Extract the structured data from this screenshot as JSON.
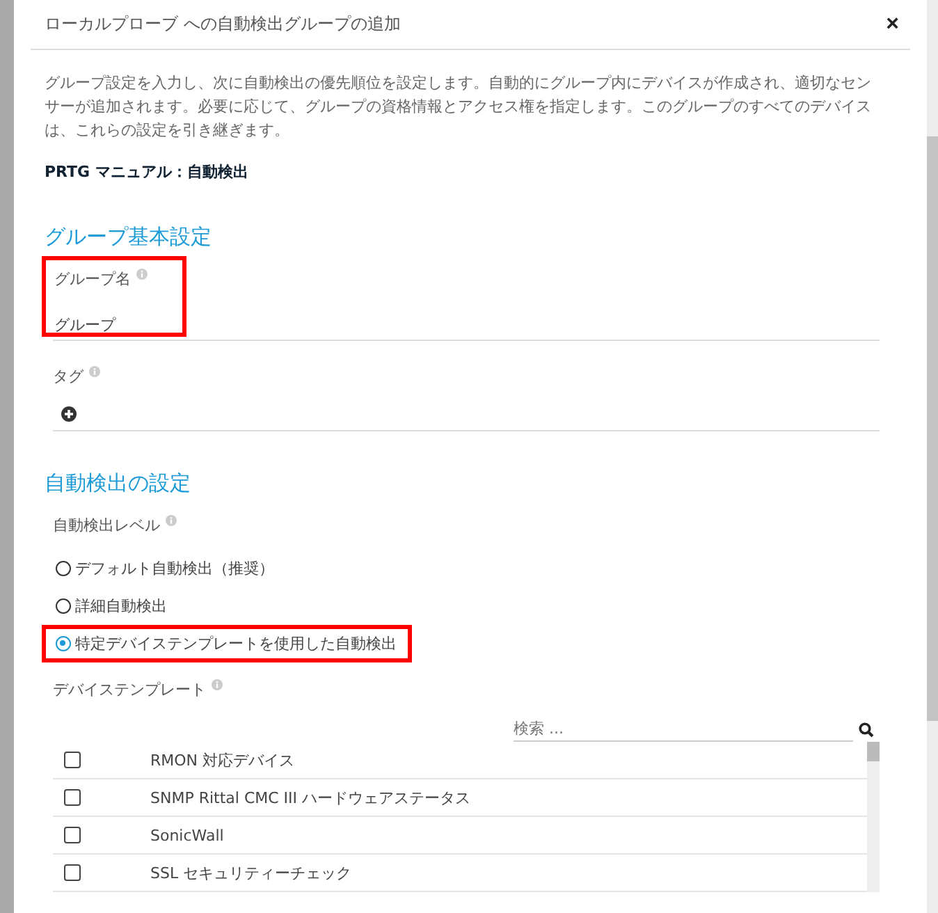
{
  "dialog": {
    "title": "ローカルプローブ への自動検出グループの追加",
    "close": "×"
  },
  "description": "グループ設定を入力し、次に自動検出の優先順位を設定します。自動的にグループ内にデバイスが作成され、適切なセンサーが追加されます。必要に応じて、グループの資格情報とアクセス権を指定します。このグループのすべてのデバイスは、これらの設定を引き継ぎます。",
  "manual_link": "PRTG マニュアル：自動検出",
  "basic_section": {
    "heading": "グループ基本設定",
    "group_name": {
      "label": "グループ名",
      "value": "グループ",
      "highlighted": true
    },
    "tags": {
      "label": "タグ"
    }
  },
  "discovery_section": {
    "heading": "自動検出の設定",
    "level_label": "自動検出レベル",
    "options": [
      {
        "label": "デフォルト自動検出（推奨）",
        "selected": false,
        "highlighted": false
      },
      {
        "label": "詳細自動検出",
        "selected": false,
        "highlighted": false
      },
      {
        "label": "特定デバイステンプレートを使用した自動検出",
        "selected": true,
        "highlighted": true
      }
    ],
    "template_label": "デバイステンプレート",
    "search": {
      "placeholder": "検索 ..."
    },
    "templates": [
      {
        "name": "RMON 対応デバイス",
        "checked": false
      },
      {
        "name": "SNMP Rittal CMC III ハードウェアステータス",
        "checked": false
      },
      {
        "name": "SonicWall",
        "checked": false
      },
      {
        "name": "SSL セキュリティーチェック",
        "checked": false
      }
    ]
  }
}
